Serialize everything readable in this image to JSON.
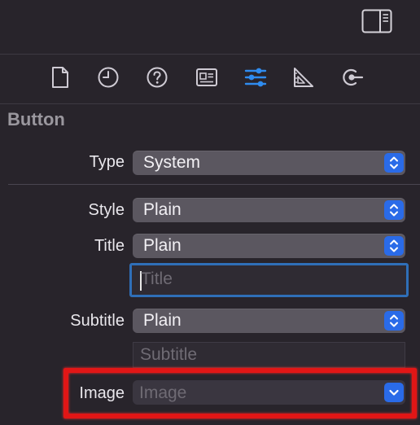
{
  "toolbar": {
    "toggle_icon": "inspector-toggle-icon"
  },
  "inspector_tabs": [
    {
      "icon": "file-icon",
      "active": false
    },
    {
      "icon": "history-icon",
      "active": false
    },
    {
      "icon": "help-icon",
      "active": false
    },
    {
      "icon": "identity-icon",
      "active": false
    },
    {
      "icon": "attributes-icon",
      "active": true
    },
    {
      "icon": "size-icon",
      "active": false
    },
    {
      "icon": "connections-icon",
      "active": false
    }
  ],
  "section": {
    "title": "Button"
  },
  "fields": {
    "type": {
      "label": "Type",
      "value": "System"
    },
    "style": {
      "label": "Style",
      "value": "Plain"
    },
    "title": {
      "label": "Title",
      "value": "Plain",
      "text_placeholder": "Title"
    },
    "subtitle": {
      "label": "Subtitle",
      "value": "Plain",
      "text_placeholder": "Subtitle"
    },
    "image": {
      "label": "Image",
      "placeholder": "Image"
    }
  },
  "colors": {
    "accent": "#2a6be8",
    "active_tab": "#2f8cf0",
    "highlight": "#e21616",
    "background": "#28242b"
  }
}
